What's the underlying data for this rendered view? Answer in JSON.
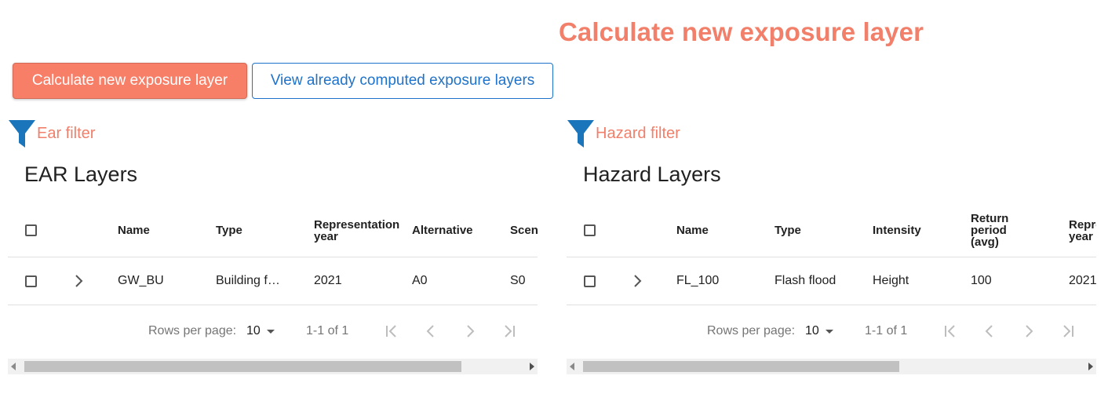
{
  "header": {
    "title": "Calculate new exposure layer"
  },
  "actions": {
    "calculate_label": "Calculate new exposure layer",
    "view_label": "View already computed exposure layers"
  },
  "ear": {
    "filter_label": "Ear filter",
    "table_title": "EAR Layers",
    "columns": [
      "Name",
      "Type",
      "Representation year",
      "Alternative",
      "Scen"
    ],
    "rows": [
      {
        "name": "GW_BU",
        "type": "Building f…",
        "year": "2021",
        "alternative": "A0",
        "scenario": "S0"
      }
    ],
    "pagination": {
      "rows_per_page_label": "Rows per page:",
      "rows_per_page": "10",
      "range": "1-1 of 1"
    },
    "scroll_fraction": 0.87
  },
  "hazard": {
    "filter_label": "Hazard filter",
    "table_title": "Hazard Layers",
    "columns": [
      "Name",
      "Type",
      "Intensity",
      "Return period (avg)",
      "Repre year"
    ],
    "rows": [
      {
        "name": "FL_100",
        "type": "Flash flood",
        "intensity": "Height",
        "return_period": "100",
        "year": "2021"
      }
    ],
    "pagination": {
      "rows_per_page_label": "Rows per page:",
      "rows_per_page": "10",
      "range": "1-1 of 1"
    },
    "scroll_fraction": 0.63
  },
  "colors": {
    "accent": "#f77f68",
    "link_blue": "#1e72c9",
    "filter_icon": "#1b75bb"
  },
  "icons": {
    "filter": "funnel-icon",
    "expand": "chevron-right-icon",
    "first": "first-page-icon",
    "prev": "chevron-left-icon",
    "next": "chevron-right-icon",
    "last": "last-page-icon"
  }
}
